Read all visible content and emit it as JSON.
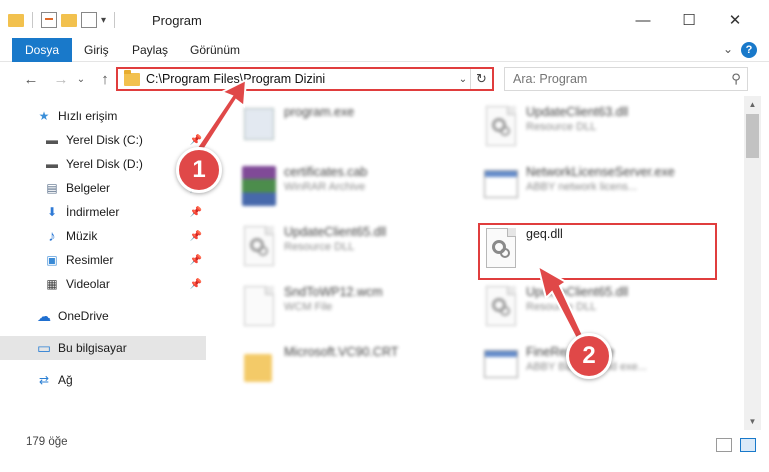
{
  "window": {
    "title": "Program",
    "minimize_glyph": "—",
    "maximize_glyph": "☐",
    "close_glyph": "✕"
  },
  "ribbon": {
    "tabs": [
      {
        "label": "Dosya",
        "active": true
      },
      {
        "label": "Giriş",
        "active": false
      },
      {
        "label": "Paylaş",
        "active": false
      },
      {
        "label": "Görünüm",
        "active": false
      }
    ],
    "help_glyph": "?",
    "expand_glyph": "⌄"
  },
  "address_bar": {
    "path": "C:\\Program Files\\Program Dizini",
    "dropdown_glyph": "⌄",
    "refresh_glyph": "↻"
  },
  "search": {
    "placeholder": "Ara: Program",
    "icon": "search-icon",
    "glyph": "⚲"
  },
  "nav_buttons": {
    "back_glyph": "←",
    "forward_glyph": "→",
    "recent_glyph": "⌄",
    "up_glyph": "↑"
  },
  "nav_pane": {
    "items": [
      {
        "label": "Hızlı erişim",
        "icon": "star-icon",
        "glyph": "★",
        "color": "#3b8fd9",
        "pinned": false
      },
      {
        "label": "Yerel Disk (C:)",
        "icon": "disk-icon",
        "glyph": "▬",
        "color": "#555555",
        "pinned": true
      },
      {
        "label": "Yerel Disk (D:)",
        "icon": "disk-icon",
        "glyph": "▬",
        "color": "#555555",
        "pinned": false
      },
      {
        "label": "Belgeler",
        "icon": "documents-icon",
        "glyph": "▤",
        "color": "#5a6f8a",
        "pinned": true
      },
      {
        "label": "İndirmeler",
        "icon": "download-icon",
        "glyph": "⬇",
        "color": "#2f7ad6",
        "pinned": true
      },
      {
        "label": "Müzik",
        "icon": "music-icon",
        "glyph": "♪",
        "color": "#2f7ad6",
        "pinned": true
      },
      {
        "label": "Resimler",
        "icon": "pictures-icon",
        "glyph": "▣",
        "color": "#3a8ad6",
        "pinned": true
      },
      {
        "label": "Videolar",
        "icon": "video-icon",
        "glyph": "▦",
        "color": "#444444",
        "pinned": true
      },
      {
        "label": "OneDrive",
        "icon": "cloud-icon",
        "glyph": "☁",
        "color": "#1f6fd0",
        "pinned": false
      },
      {
        "label": "Bu bilgisayar",
        "icon": "computer-icon",
        "glyph": "▭",
        "color": "#2a7fd4",
        "pinned": false,
        "selected": true
      },
      {
        "label": "Ağ",
        "icon": "network-icon",
        "glyph": "⇄",
        "color": "#2a7fd4",
        "pinned": false
      }
    ],
    "pin_glyph": "📌"
  },
  "files": [
    {
      "name": "program.exe",
      "type": "",
      "icon": "exe-icon",
      "blurred": true
    },
    {
      "name": "UpdateClient63.dll",
      "type": "Resource DLL",
      "icon": "dll-icon",
      "blurred": true
    },
    {
      "name": "certificates.cab",
      "type": "WinRAR Archive",
      "icon": "winrar-icon",
      "blurred": true
    },
    {
      "name": "NetworkLicenseServer.exe",
      "type": "ABBY network licens...",
      "icon": "app-icon",
      "blurred": true
    },
    {
      "name": "UpdateClient65.dll",
      "type": "Resource DLL",
      "icon": "dll-icon",
      "blurred": true
    },
    {
      "name": "geq.dll",
      "type": "",
      "icon": "dll-icon",
      "blurred": false
    },
    {
      "name": "SndToWP12.wcm",
      "type": "WCM File",
      "icon": "file-icon",
      "blurred": true
    },
    {
      "name": "UpdateClient65.dll",
      "type": "Resource DLL",
      "icon": "dll-icon",
      "blurred": true
    },
    {
      "name": "Microsoft.VC90.CRT",
      "type": "",
      "icon": "folder-icon",
      "blurred": true
    },
    {
      "name": "FineReader.exe",
      "type": "ABBY Background exe...",
      "icon": "app-icon",
      "blurred": true
    }
  ],
  "status_bar": {
    "item_count": "179 öğe"
  },
  "callouts": [
    {
      "label": "1"
    },
    {
      "label": "2"
    }
  ],
  "colors": {
    "accent": "#1979ca",
    "highlight": "#e03d3d",
    "callout": "#e04848"
  }
}
